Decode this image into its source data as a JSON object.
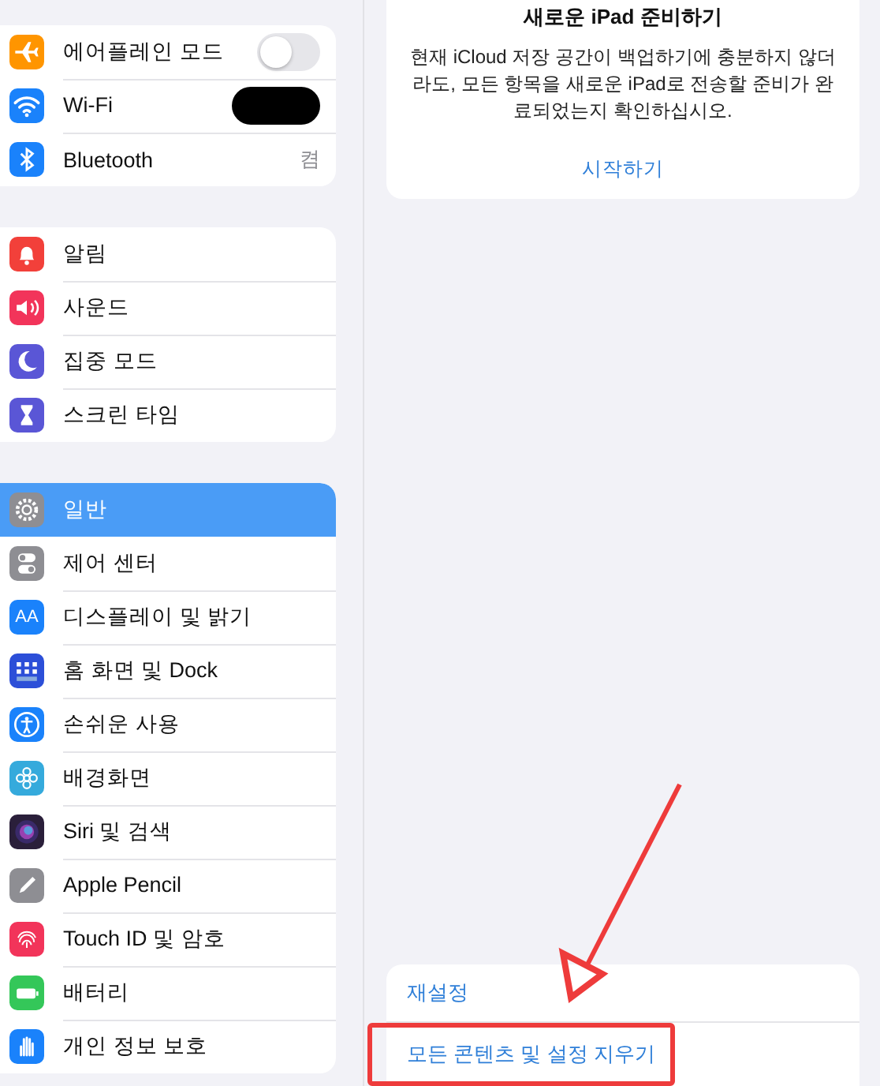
{
  "sidebar": {
    "groups": [
      {
        "items": [
          {
            "label": "에어플레인 모드",
            "color": "#ff9500",
            "selected": false,
            "accessory": {
              "kind": "toggle",
              "on": false
            }
          },
          {
            "label": "Wi-Fi",
            "color": "#1a82fb",
            "selected": false,
            "accessory": {
              "kind": "redacted"
            }
          },
          {
            "label": "Bluetooth",
            "color": "#1a82fb",
            "selected": false,
            "accessory": {
              "kind": "value",
              "text": "켬"
            }
          }
        ]
      },
      {
        "items": [
          {
            "label": "알림",
            "color": "#f2403a",
            "selected": false
          },
          {
            "label": "사운드",
            "color": "#f2345a",
            "selected": false
          },
          {
            "label": "집중 모드",
            "color": "#5a56d6",
            "selected": false
          },
          {
            "label": "스크린 타임",
            "color": "#5a56d6",
            "selected": false
          }
        ]
      },
      {
        "items": [
          {
            "label": "일반",
            "color": "#8e8e93",
            "selected": true
          },
          {
            "label": "제어 센터",
            "color": "#8e8e93",
            "selected": false
          },
          {
            "label": "디스플레이 및 밝기",
            "color": "#1a82fb",
            "selected": false,
            "icon_text": "AA"
          },
          {
            "label": "홈 화면 및 Dock",
            "color": "#2c4fd8",
            "selected": false
          },
          {
            "label": "손쉬운 사용",
            "color": "#1a82fb",
            "selected": false
          },
          {
            "label": "배경화면",
            "color": "#35aadc",
            "selected": false
          },
          {
            "label": "Siri 및 검색",
            "color": "#2a1f3a",
            "selected": false
          },
          {
            "label": "Apple Pencil",
            "color": "#8e8e93",
            "selected": false
          },
          {
            "label": "Touch ID 및 암호",
            "color": "#f2345a",
            "selected": false
          },
          {
            "label": "배터리",
            "color": "#34c759",
            "selected": false
          },
          {
            "label": "개인 정보 보호",
            "color": "#1a82fb",
            "selected": false
          }
        ]
      }
    ]
  },
  "prepare_card": {
    "title": "새로운 iPad 준비하기",
    "body": "현재 iCloud 저장 공간이 백업하기에 충분하지 않더라도, 모든 항목을 새로운 iPad로 전송할 준비가 완료되었는지 확인하십시오.",
    "action": "시작하기"
  },
  "reset_list": [
    {
      "label": "재설정",
      "highlighted": false
    },
    {
      "label": "모든 콘텐츠 및 설정 지우기",
      "highlighted": true
    }
  ]
}
